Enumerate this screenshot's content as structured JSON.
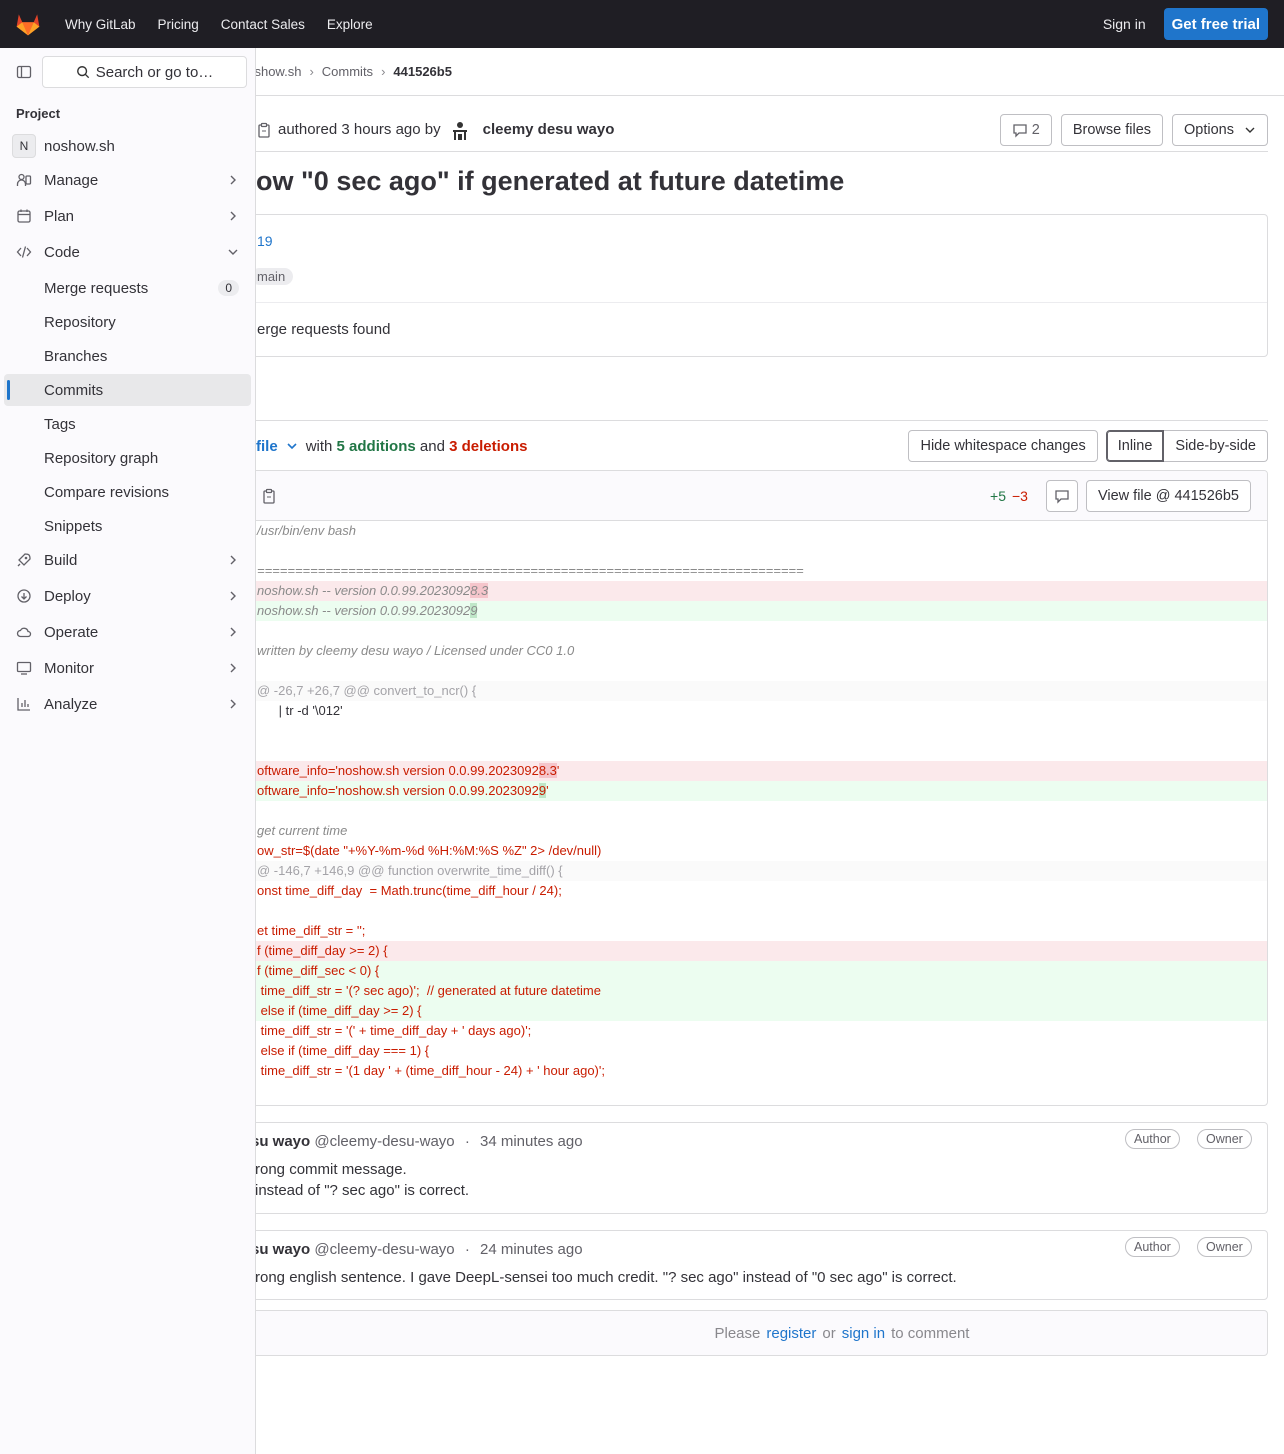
{
  "topnav": {
    "links": [
      "Why GitLab",
      "Pricing",
      "Contact Sales",
      "Explore"
    ],
    "sign_in": "Sign in",
    "trial": "Get free trial"
  },
  "breadcrumb": {
    "project": "noshow.sh",
    "section": "Commits",
    "sha": "441526b5"
  },
  "commit": {
    "authored": "authored 3 hours ago by",
    "author": "cleemy desu wayo",
    "comments_count": "2",
    "browse_files": "Browse files",
    "options": "Options",
    "title": "ow \"0 sec ago\" if generated at future datetime",
    "parent_link": "19",
    "branch": "main",
    "merge_requests": "erge requests found"
  },
  "files": {
    "file_label": "file",
    "with": "with",
    "additions": "5 additions",
    "and": "and",
    "deletions": "3 deletions",
    "hide_whitespace": "Hide whitespace changes",
    "inline": "Inline",
    "side_by_side": "Side-by-side"
  },
  "diff": {
    "plus": "+5",
    "minus": "−3",
    "view_file": "View file @ 441526b5",
    "lines": [
      {
        "type": "ctx",
        "cls": "c-com",
        "text": "/usr/bin/env bash"
      },
      {
        "type": "ctx",
        "cls": "",
        "text": ""
      },
      {
        "type": "ctx",
        "cls": "c-com",
        "text": "========================================================================"
      },
      {
        "type": "old",
        "cls": "c-com",
        "pre": "noshow.sh -- version 0.0.99.2023092",
        "hl": "8.3",
        "post": ""
      },
      {
        "type": "new",
        "cls": "c-com",
        "pre": "noshow.sh -- version 0.0.99.2023092",
        "hl": "9",
        "post": ""
      },
      {
        "type": "ctx",
        "cls": "",
        "text": ""
      },
      {
        "type": "ctx",
        "cls": "c-com",
        "text": "written by cleemy desu wayo / Licensed under CC0 1.0"
      },
      {
        "type": "ctx",
        "cls": "",
        "text": ""
      },
      {
        "type": "hunk",
        "cls": "",
        "text": "@ -26,7 +26,7 @@ convert_to_ncr() {"
      },
      {
        "type": "ctx",
        "cls": "",
        "text": "      | tr -d '\\012'"
      },
      {
        "type": "ctx",
        "cls": "",
        "text": ""
      },
      {
        "type": "ctx",
        "cls": "",
        "text": ""
      },
      {
        "type": "old",
        "cls": "c-str",
        "pre": "oftware_info='noshow.sh version 0.0.99.2023092",
        "hl": "8.3",
        "post": "'"
      },
      {
        "type": "new",
        "cls": "c-str",
        "pre": "oftware_info='noshow.sh version 0.0.99.2023092",
        "hl": "9",
        "post": "'"
      },
      {
        "type": "ctx",
        "cls": "",
        "text": ""
      },
      {
        "type": "ctx",
        "cls": "c-com",
        "text": "get current time"
      },
      {
        "type": "ctx",
        "cls": "c-red",
        "text": "ow_str=$(date \"+%Y-%m-%d %H:%M:%S %Z\" 2> /dev/null)"
      },
      {
        "type": "hunk",
        "cls": "",
        "text": "@ -146,7 +146,9 @@ function overwrite_time_diff() {"
      },
      {
        "type": "ctx",
        "cls": "c-red",
        "text": "onst time_diff_day  = Math.trunc(time_diff_hour / 24);"
      },
      {
        "type": "ctx",
        "cls": "",
        "text": ""
      },
      {
        "type": "ctx",
        "cls": "c-red",
        "text": "et time_diff_str = '';"
      },
      {
        "type": "old",
        "cls": "c-red",
        "text": "f (time_diff_day >= 2) {"
      },
      {
        "type": "new",
        "cls": "c-red",
        "text": "f (time_diff_sec < 0) {"
      },
      {
        "type": "new",
        "cls": "c-red",
        "text": " time_diff_str = '(? sec ago)';  // generated at future datetime"
      },
      {
        "type": "new",
        "cls": "c-red",
        "text": " else if (time_diff_day >= 2) {"
      },
      {
        "type": "ctx",
        "cls": "c-red",
        "text": " time_diff_str = '(' + time_diff_day + ' days ago)';"
      },
      {
        "type": "ctx",
        "cls": "c-red",
        "text": " else if (time_diff_day === 1) {"
      },
      {
        "type": "ctx",
        "cls": "c-red",
        "text": " time_diff_str = '(1 day ' + (time_diff_hour - 24) + ' hour ago)';"
      }
    ]
  },
  "notes": [
    {
      "name": "su wayo",
      "handle": "@cleemy-desu-wayo",
      "time": "34 minutes ago",
      "author_badge": "Author",
      "owner_badge": "Owner",
      "body": [
        "rong commit message.",
        " instead of \"? sec ago\" is correct."
      ]
    },
    {
      "name": "su wayo",
      "handle": "@cleemy-desu-wayo",
      "time": "24 minutes ago",
      "author_badge": "Author",
      "owner_badge": "Owner",
      "body": [
        "rong english sentence. I gave DeepL-sensei too much credit. \"? sec ago\" instead of \"0 sec ago\" is correct."
      ]
    }
  ],
  "comment_prompt": {
    "please": "Please",
    "register": "register",
    "or": "or",
    "sign_in": "sign in",
    "to_comment": "to comment"
  },
  "sidebar": {
    "search": "Search or go to…",
    "section": "Project",
    "project_initial": "N",
    "project_name": "noshow.sh",
    "items": [
      {
        "label": "Manage",
        "icon": "users-icon"
      },
      {
        "label": "Plan",
        "icon": "calendar-icon"
      },
      {
        "label": "Code",
        "icon": "code-icon"
      },
      {
        "label": "Merge requests",
        "count": "0"
      },
      {
        "label": "Repository"
      },
      {
        "label": "Branches"
      },
      {
        "label": "Commits"
      },
      {
        "label": "Tags"
      },
      {
        "label": "Repository graph"
      },
      {
        "label": "Compare revisions"
      },
      {
        "label": "Snippets"
      },
      {
        "label": "Build",
        "icon": "rocket-icon"
      },
      {
        "label": "Deploy",
        "icon": "deploy-icon"
      },
      {
        "label": "Operate",
        "icon": "cloud-icon"
      },
      {
        "label": "Monitor",
        "icon": "monitor-icon"
      },
      {
        "label": "Analyze",
        "icon": "chart-icon"
      }
    ]
  }
}
